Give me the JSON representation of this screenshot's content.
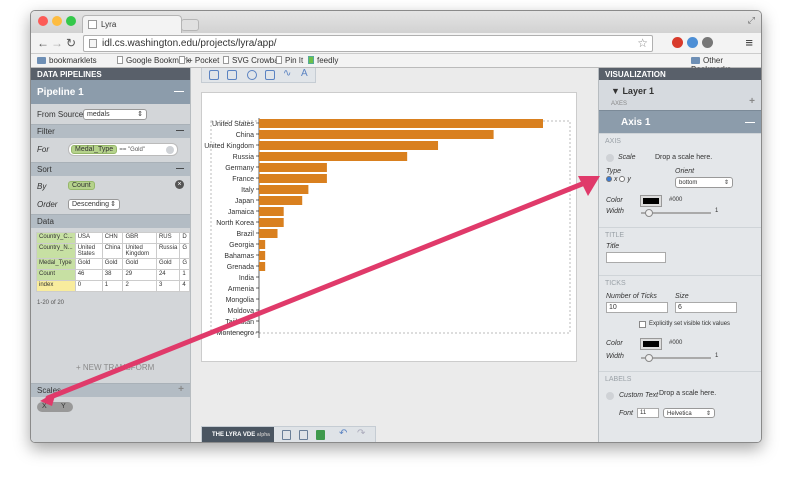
{
  "browser": {
    "tab_title": "Lyra",
    "url": "idl.cs.washington.edu/projects/lyra/app/",
    "bookmarks": [
      "bookmarklets",
      "Google Bookmark",
      "+ Pocket",
      "SVG Crowbar",
      "Pin It",
      "feedly"
    ],
    "other_bookmarks": "Other Bookmarks"
  },
  "left": {
    "header": "DATA PIPELINES",
    "pipeline": "Pipeline 1",
    "from_source_label": "From Source:",
    "from_source_value": "medals",
    "filter_header": "Filter",
    "filter_label": "For",
    "filter_field": "Medal_Type",
    "filter_expr": "== \"Gold\"",
    "sort_header": "Sort",
    "sort_by_label": "By",
    "sort_by_value": "Count",
    "sort_order_label": "Order",
    "sort_order_value": "Descending",
    "data_header": "Data",
    "table": [
      [
        "Country_C...",
        "USA",
        "CHN",
        "GBR",
        "RUS",
        "D"
      ],
      [
        "Country_N...",
        "United States",
        "China",
        "United Kingdom",
        "Russia",
        "G"
      ],
      [
        "Medal_Type",
        "Gold",
        "Gold",
        "Gold",
        "Gold",
        "G"
      ],
      [
        "Count",
        "46",
        "38",
        "29",
        "24",
        "1"
      ],
      [
        "index",
        "0",
        "1",
        "2",
        "3",
        "4"
      ]
    ],
    "paging": "1-20 of 20",
    "new_transform": "+ NEW TRANSFORM",
    "scales_header": "Scales",
    "scale_x": "X",
    "scale_y": "Y"
  },
  "center": {
    "logo": "THE LYRA VDE",
    "logo_sub": "alpha"
  },
  "chart_data": {
    "type": "bar",
    "orientation": "horizontal",
    "categories": [
      "United States",
      "China",
      "United Kingdom",
      "Russia",
      "Germany",
      "France",
      "Italy",
      "Japan",
      "Jamaica",
      "North Korea",
      "Brazil",
      "Georgia",
      "Bahamas",
      "Grenada",
      "India",
      "Armenia",
      "Mongolia",
      "Moldova",
      "Tajikistan",
      "Montenegro"
    ],
    "values": [
      46,
      38,
      29,
      24,
      11,
      11,
      8,
      7,
      4,
      4,
      3,
      1,
      1,
      1,
      0,
      0,
      0,
      0,
      0,
      0
    ],
    "xlim": [
      0,
      46
    ],
    "bar_color": "#d9801f",
    "grid": false
  },
  "right": {
    "header": "VISUALIZATION",
    "layer": "Layer 1",
    "axes_label": "AXES",
    "axis_title": "Axis 1",
    "axis_group": "AXIS",
    "scale_label": "Scale",
    "scale_hint": "Drop a scale here.",
    "type_label": "Type",
    "type_x": "x",
    "type_y": "y",
    "orient_label": "Orient",
    "orient_value": "bottom",
    "color_label": "Color",
    "color_value": "#000",
    "width_label": "Width",
    "width_value": "1",
    "title_group": "TITLE",
    "title_label": "Title",
    "ticks_group": "TICKS",
    "num_ticks_label": "Number of Ticks",
    "num_ticks_value": "10",
    "size_label": "Size",
    "size_value": "6",
    "explicit_label": "Explicitly set visible tick values",
    "tick_color_label": "Color",
    "tick_color_value": "#000",
    "tick_width_label": "Width",
    "tick_width_value": "1",
    "labels_group": "LABELS",
    "custom_text_label": "Custom Text",
    "custom_hint": "Drop a scale here.",
    "font_label": "Font",
    "font_size": "11",
    "font_family": "Helvetica"
  },
  "colors": {
    "arrow": "#e03a6a",
    "accent": "#8c9cab"
  }
}
